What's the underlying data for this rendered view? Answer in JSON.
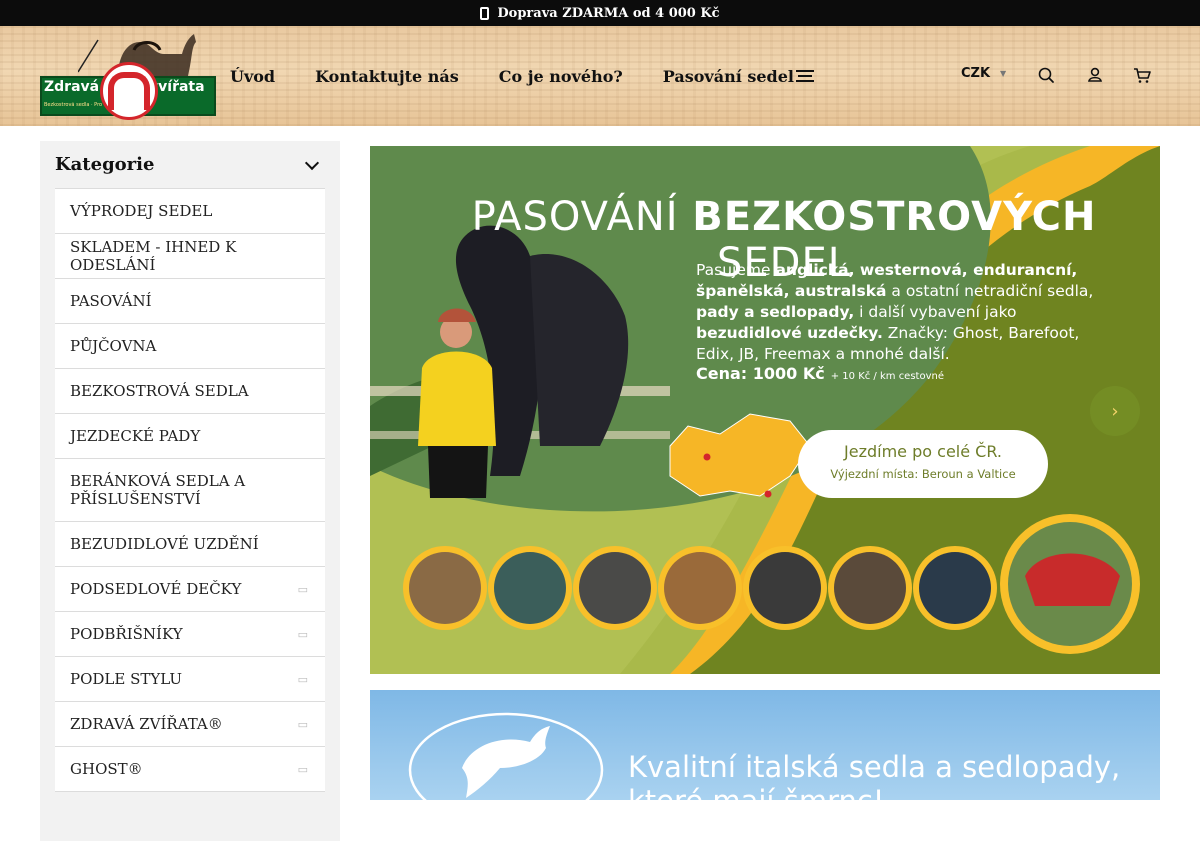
{
  "topbar": {
    "text": "Doprava ZDARMA od 4 000 Kč",
    "icon": "truck-icon"
  },
  "logo": {
    "word1": "Zdravá",
    "word2": "zvířata",
    "tagline": "Bezkostrová sedla · Pro radost z pohybu"
  },
  "nav": [
    {
      "label": "Úvod"
    },
    {
      "label": "Kontaktujte nás"
    },
    {
      "label": "Co je nového?"
    },
    {
      "label": "Pasování sedel"
    }
  ],
  "header": {
    "currency": "CZK",
    "icons": [
      "menu-icon",
      "search-icon",
      "user-icon",
      "cart-icon"
    ]
  },
  "sidebar": {
    "title": "Kategorie",
    "items": [
      {
        "label": "VÝPRODEJ SEDEL",
        "expandable": false
      },
      {
        "label": "SKLADEM - IHNED K ODESLÁNÍ",
        "expandable": false
      },
      {
        "label": "PASOVÁNÍ",
        "expandable": false
      },
      {
        "label": "PŮJČOVNA",
        "expandable": false
      },
      {
        "label": "BEZKOSTROVÁ SEDLA",
        "expandable": false
      },
      {
        "label": "JEZDECKÉ PADY",
        "expandable": false
      },
      {
        "label": "BERÁNKOVÁ SEDLA A PŘÍSLUŠENSTVÍ",
        "expandable": false
      },
      {
        "label": "BEZUDIDLOVÉ UZDĚNÍ",
        "expandable": false
      },
      {
        "label": "PODSEDLOVÉ DEČKY",
        "expandable": true
      },
      {
        "label": "PODBŘIŠNÍKY",
        "expandable": true
      },
      {
        "label": "PODLE STYLU",
        "expandable": true
      },
      {
        "label": "ZDRAVÁ ZVÍŘATA®",
        "expandable": true
      },
      {
        "label": "GHOST®",
        "expandable": true
      }
    ]
  },
  "banner1": {
    "title_light1": "PASOVÁNÍ",
    "title_bold": "BEZKOSTROVÝCH",
    "title_light2": "SEDEL",
    "text_parts": [
      "Pasujeme ",
      "anglická, westernová, endurancní, španělská, australská",
      " a ostatní netradiční sedla, ",
      "pady a sedlopady,",
      " i další vybavení jako ",
      "bezudidlové uzdečky.",
      " Značky: Ghost, Barefoot, Edix, JB, Freemax a mnohé další."
    ],
    "price": "Cena: 1000 Kč",
    "price_note": "+ 10 Kč / km cestovné",
    "pill_line1": "Jezdíme po celé ČR.",
    "pill_line2": "Výjezdní místa: Beroun a Valtice",
    "arrow": "›"
  },
  "banner2": {
    "line1": "Kvalitní italská sedla a sedlopady,",
    "line2": "které mají šmrnc!"
  },
  "colors": {
    "olive": "#6f8420",
    "mustard": "#f6b626",
    "logo_green": "#0a6a2a",
    "horseshoe_red": "#d4252b"
  }
}
